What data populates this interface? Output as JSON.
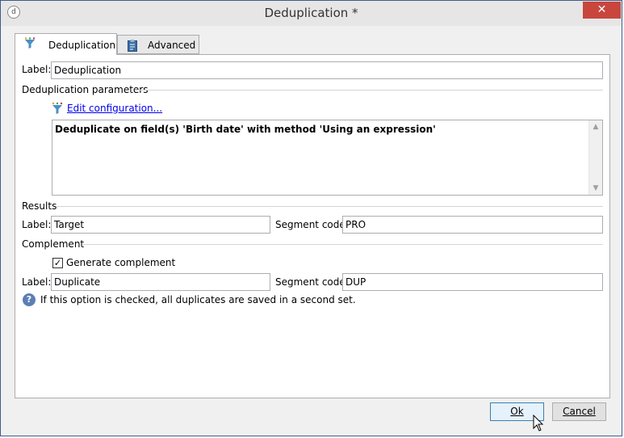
{
  "window": {
    "title": "Deduplication *",
    "close_glyph": "✕",
    "app_icon_glyph": "d"
  },
  "tabs": [
    {
      "label": "Deduplication",
      "icon": "funnel-icon",
      "active": true
    },
    {
      "label": "Advanced",
      "icon": "clipboard-icon",
      "active": false
    }
  ],
  "form": {
    "label_caption": "Label:",
    "label_value": "Deduplication",
    "dedup_section": "Deduplication parameters",
    "edit_link": "Edit configuration...",
    "summary_text": "Deduplicate on field(s) 'Birth date' with method 'Using an expression'",
    "results_section": "Results",
    "results_label_caption": "Label:",
    "results_label_value": "Target",
    "results_segment_caption": "Segment code:",
    "results_segment_value": "PRO",
    "complement_section": "Complement",
    "generate_complement_label": "Generate complement",
    "generate_complement_checked": true,
    "complement_label_caption": "Label:",
    "complement_label_value": "Duplicate",
    "complement_segment_caption": "Segment code:",
    "complement_segment_value": "DUP",
    "info_text": "If this option is checked, all duplicates are saved in a second set."
  },
  "buttons": {
    "ok_label": "Ok",
    "cancel_label": "Cancel"
  },
  "colors": {
    "link": "#0000ee",
    "info_icon": "#5a7fb5",
    "close_button": "#c9463d"
  }
}
